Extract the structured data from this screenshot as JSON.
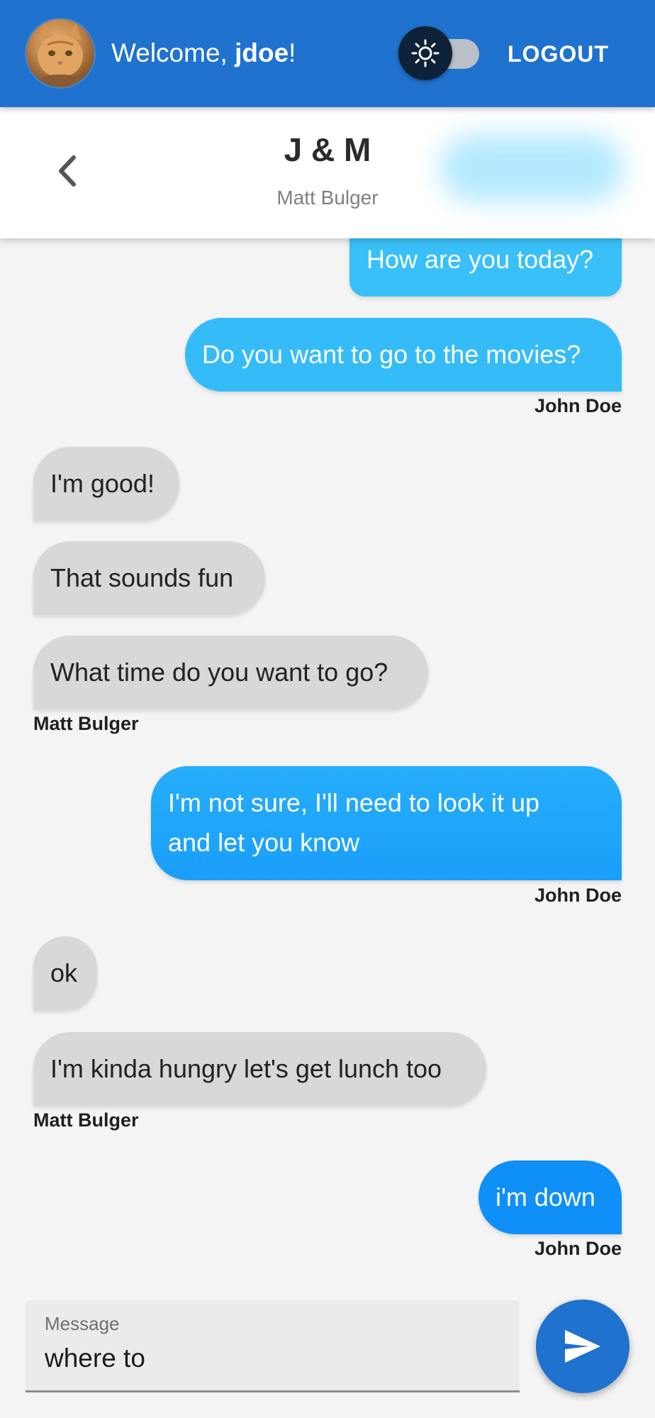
{
  "appbar": {
    "welcome_prefix": "Welcome, ",
    "username": "jdoe",
    "welcome_suffix": "!",
    "theme_toggle_icon": "sun-icon",
    "logout_label": "LOGOUT",
    "bar_color": "#1f72cd"
  },
  "conversation": {
    "title": "J & M",
    "subtitle": "Matt Bulger"
  },
  "messages": [
    {
      "dir": "out",
      "text": "How are you today?"
    },
    {
      "dir": "out",
      "text": "Do you want to go to the movies?"
    },
    {
      "sender": "John Doe"
    },
    {
      "dir": "in",
      "text": "I'm good!"
    },
    {
      "dir": "in",
      "text": "That sounds fun"
    },
    {
      "dir": "in",
      "text": "What time do you want to go?"
    },
    {
      "sender": "Matt Bulger"
    },
    {
      "dir": "out",
      "text": "I'm not sure, I'll need to look it up",
      "text2": "and let you know"
    },
    {
      "sender": "John Doe"
    },
    {
      "dir": "in",
      "text": "ok"
    },
    {
      "dir": "in",
      "text": "I'm kinda hungry let's get lunch too"
    },
    {
      "sender": "Matt Bulger"
    },
    {
      "dir": "out",
      "text": "i'm down"
    },
    {
      "sender": "John Doe"
    }
  ],
  "composer": {
    "label": "Message",
    "value": "where to",
    "send_icon": "send-icon"
  },
  "colors": {
    "outgoing_top": "#3ec4f8",
    "outgoing_bottom": "#0f8ff8",
    "incoming": "#d8d8d8",
    "send_button": "#1f72cd"
  }
}
